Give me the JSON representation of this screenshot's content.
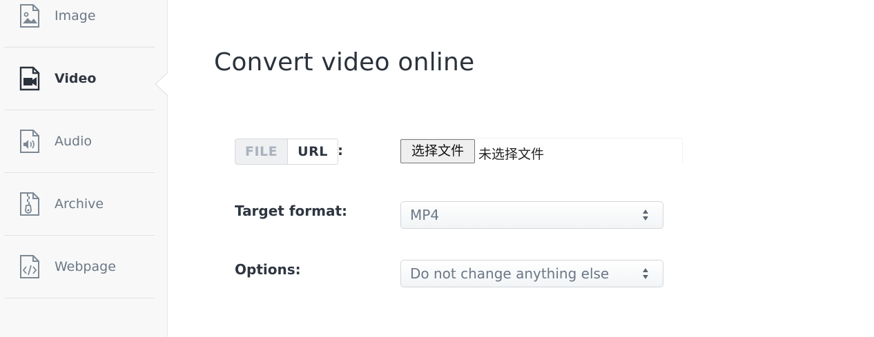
{
  "sidebar": {
    "items": [
      {
        "label": "Image",
        "icon": "image-file-icon",
        "active": false
      },
      {
        "label": "Video",
        "icon": "video-file-icon",
        "active": true
      },
      {
        "label": "Audio",
        "icon": "audio-file-icon",
        "active": false
      },
      {
        "label": "Archive",
        "icon": "archive-file-icon",
        "active": false
      },
      {
        "label": "Webpage",
        "icon": "code-file-icon",
        "active": false
      }
    ]
  },
  "main": {
    "title": "Convert video online",
    "source": {
      "file_label": "FILE",
      "url_label": "URL",
      "colon": ":",
      "choose_button": "选择文件",
      "no_file_text": "未选择文件"
    },
    "target_format": {
      "label": "Target format:",
      "selected": "MP4"
    },
    "options": {
      "label": "Options:",
      "selected": "Do not change anything else"
    }
  },
  "colors": {
    "sidebar_bg": "#f8f8f8",
    "text_dark": "#2f3640",
    "text_muted": "#6b7785"
  }
}
